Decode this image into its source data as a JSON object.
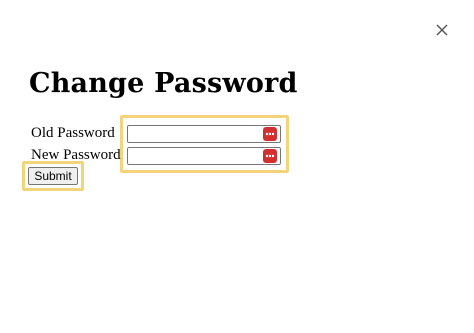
{
  "dialog": {
    "title": "Change Password",
    "close_icon": "close-icon"
  },
  "form": {
    "old_password": {
      "label": "Old Password",
      "value": "",
      "placeholder": "",
      "icon": "password-manager-icon"
    },
    "new_password": {
      "label": "New Password",
      "value": "",
      "placeholder": "",
      "icon": "password-manager-icon"
    },
    "submit_label": "Submit"
  },
  "colors": {
    "highlight": "#f2d47a",
    "password_manager_icon": "#d32f2f"
  }
}
